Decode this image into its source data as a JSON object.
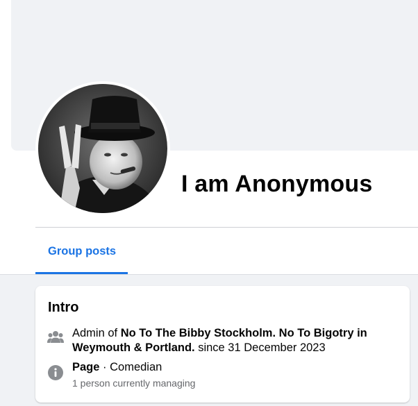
{
  "profile": {
    "name": "I am Anonymous"
  },
  "tabs": [
    {
      "label": "Group posts",
      "active": true
    }
  ],
  "intro": {
    "title": "Intro",
    "admin": {
      "prefix": "Admin of ",
      "group": "No To The Bibby Stockholm. No To Bigotry in Weymouth & Portland.",
      "since": " since 31 December 2023",
      "icon": "group-icon"
    },
    "page": {
      "label": "Page",
      "separator": " · ",
      "category": "Comedian",
      "managing": "1 person currently managing",
      "icon": "info-icon"
    }
  },
  "colors": {
    "accent": "#1b74e4",
    "text": "#050505",
    "secondary_text": "#65676b",
    "background": "#f0f2f5"
  }
}
